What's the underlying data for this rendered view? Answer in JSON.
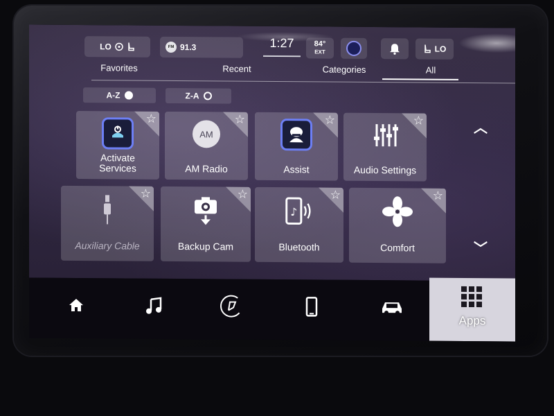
{
  "status_bar": {
    "seat_label": "LO",
    "radio_band": "FM",
    "radio_station": "91.3",
    "time": "1:27",
    "temperature": "84°",
    "temperature_label": "EXT",
    "heat_label": "LO"
  },
  "tabs": [
    {
      "label": "Favorites",
      "active": false
    },
    {
      "label": "Recent",
      "active": false
    },
    {
      "label": "Categories",
      "active": false
    },
    {
      "label": "All",
      "active": true
    }
  ],
  "sort": {
    "az_label": "A-Z",
    "za_label": "Z-A",
    "selected": "A-Z"
  },
  "apps": [
    {
      "label_line1": "Activate",
      "label_line2": "Services",
      "icon": "activate-services-icon",
      "enabled": true
    },
    {
      "label": "AM Radio",
      "icon_text": "AM",
      "icon": "am-radio-icon",
      "enabled": true
    },
    {
      "label": "Assist",
      "icon": "assist-icon",
      "enabled": true
    },
    {
      "label": "Audio Settings",
      "icon": "equalizer-icon",
      "enabled": true
    },
    {
      "label": "Auxiliary Cable",
      "icon": "aux-cable-icon",
      "enabled": false
    },
    {
      "label": "Backup Cam",
      "icon": "backup-camera-icon",
      "enabled": true
    },
    {
      "label": "Bluetooth",
      "icon": "bluetooth-phone-icon",
      "enabled": true
    },
    {
      "label": "Comfort",
      "icon": "fan-icon",
      "enabled": true
    }
  ],
  "bottom_nav": {
    "items": [
      "home-icon",
      "music-icon",
      "climate-icon",
      "phone-icon",
      "vehicle-icon"
    ],
    "apps_label": "Apps"
  },
  "colors": {
    "accent_blue": "#6d7ff5",
    "tile_bg": "rgba(255,255,255,0.18)",
    "apps_active_bg": "#d7d5de"
  }
}
